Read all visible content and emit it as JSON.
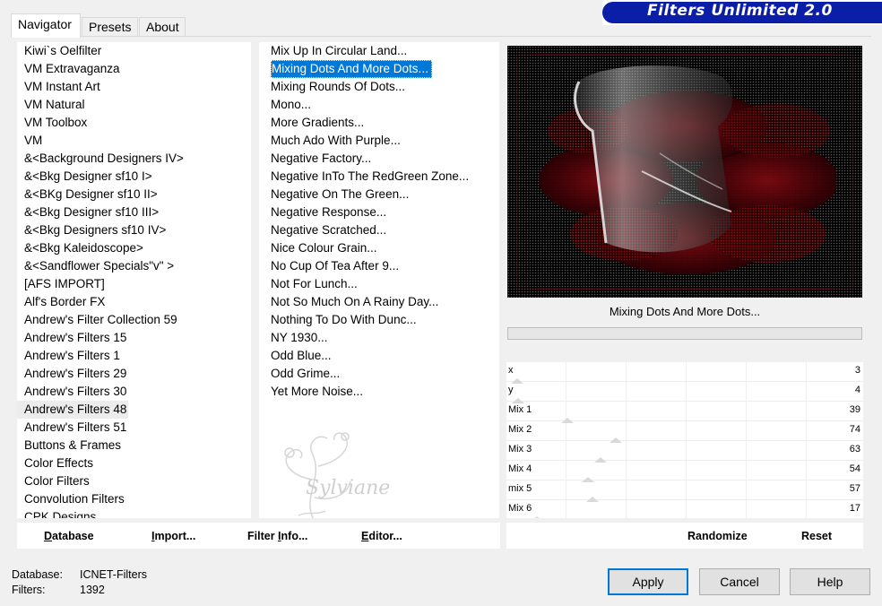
{
  "app": {
    "banner_title": "Filters Unlimited 2.0"
  },
  "tabs": [
    {
      "label": "Navigator",
      "active": true
    },
    {
      "label": "Presets",
      "active": false
    },
    {
      "label": "About",
      "active": false
    }
  ],
  "categories": [
    " Kiwi`s Oelfilter",
    " VM Extravaganza",
    " VM Instant Art",
    " VM Natural",
    " VM Toolbox",
    " VM",
    "&<Background Designers IV>",
    "&<Bkg Designer sf10 I>",
    "&<BKg Designer sf10 II>",
    "&<Bkg Designer sf10 III>",
    "&<Bkg Designers sf10 IV>",
    "&<Bkg Kaleidoscope>",
    "&<Sandflower Specials\"v\" >",
    "[AFS IMPORT]",
    "Alf's Border FX",
    "Andrew's Filter Collection 59",
    "Andrew's Filters 15",
    "Andrew's Filters 1",
    "Andrew's Filters 29",
    "Andrew's Filters 30",
    "Andrew's Filters 48",
    "Andrew's Filters 51",
    "Buttons & Frames",
    "Color Effects",
    "Color Filters",
    "Convolution Filters",
    "CPK Designs"
  ],
  "selected_category_index": 20,
  "filters": [
    "Mix Up In Circular Land...",
    "Mixing Dots And More Dots...",
    "Mixing Rounds Of Dots...",
    "Mono...",
    "More Gradients...",
    "Much Ado With Purple...",
    "Negative Factory...",
    "Negative InTo The RedGreen Zone...",
    "Negative On The Green...",
    "Negative Response...",
    "Negative Scratched...",
    "Nice Colour Grain...",
    "No Cup Of Tea After 9...",
    "Not For Lunch...",
    "Not So Much On A Rainy Day...",
    "Nothing To Do With Dunc...",
    "NY 1930...",
    "Odd Blue...",
    "Odd Grime...",
    "Yet More Noise..."
  ],
  "selected_filter_index": 1,
  "preview": {
    "label": "Mixing Dots And More Dots..."
  },
  "controls": [
    {
      "name": "x",
      "value": "3",
      "level": 0.012
    },
    {
      "name": "y",
      "value": "4",
      "level": 0.016
    },
    {
      "name": "Mix 1",
      "value": "39",
      "level": 0.153
    },
    {
      "name": "Mix 2",
      "value": "74",
      "level": 0.29
    },
    {
      "name": "Mix 3",
      "value": "63",
      "level": 0.247
    },
    {
      "name": "Mix 4",
      "value": "54",
      "level": 0.212
    },
    {
      "name": "mix 5",
      "value": "57",
      "level": 0.224
    },
    {
      "name": "Mix 6",
      "value": "17",
      "level": 0.067
    }
  ],
  "buttons_left": [
    {
      "label": "Database",
      "mnemonic": "D"
    },
    {
      "label": "Import...",
      "mnemonic": "I"
    },
    {
      "label": "Filter Info...",
      "mnemonic": "I"
    },
    {
      "label": "Editor...",
      "mnemonic": "E"
    }
  ],
  "buttons_right": {
    "randomize": "Randomize",
    "reset": "Reset"
  },
  "footer": {
    "database_label": "Database:",
    "database_value": "ICNET-Filters",
    "filters_label": "Filters:",
    "filters_value": "1392"
  },
  "dialog_buttons": {
    "apply": "Apply",
    "cancel": "Cancel",
    "help": "Help"
  },
  "watermark_text": "Sylviane",
  "colors": {
    "selection": "#0078d7",
    "banner": "#0a1ea8",
    "accent_red": "#b0101a"
  }
}
